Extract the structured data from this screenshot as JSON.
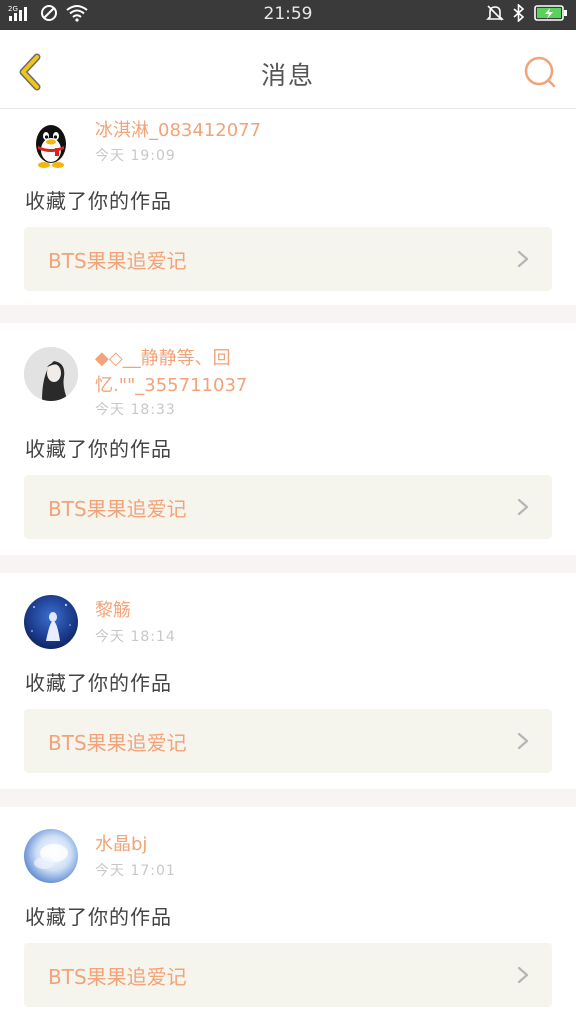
{
  "status_bar": {
    "time": "21:59",
    "network_label": "2G",
    "icons": [
      "signal-icon",
      "no-sim-icon",
      "wifi-icon",
      "mute-icon",
      "bluetooth-icon",
      "battery-charging-icon"
    ]
  },
  "header": {
    "title": "消息",
    "back_icon": "chevron-left-icon",
    "search_icon": "search-icon"
  },
  "colors": {
    "accent": "#f2a379",
    "back_icon": "#f0c419",
    "divider": "#f8f4f4",
    "work_box_bg": "#f5f5ee"
  },
  "messages": [
    {
      "username": "冰淇淋_083412077",
      "time": "今天  19:09",
      "action": "收藏了你的作品",
      "work_title": "BTS果果追爱记",
      "avatar": "qq-penguin-avatar"
    },
    {
      "username": "◆◇__静静等、回忆.\"\"_355711037",
      "time": "今天  18:33",
      "action": "收藏了你的作品",
      "work_title": "BTS果果追爱记",
      "avatar": "girl-portrait-avatar"
    },
    {
      "username": "黎觞",
      "time": "今天  18:14",
      "action": "收藏了你的作品",
      "work_title": "BTS果果追爱记",
      "avatar": "blue-night-avatar"
    },
    {
      "username": "水晶bj",
      "time": "今天  17:01",
      "action": "收藏了你的作品",
      "work_title": "BTS果果追爱记",
      "avatar": "blue-sky-avatar"
    }
  ]
}
